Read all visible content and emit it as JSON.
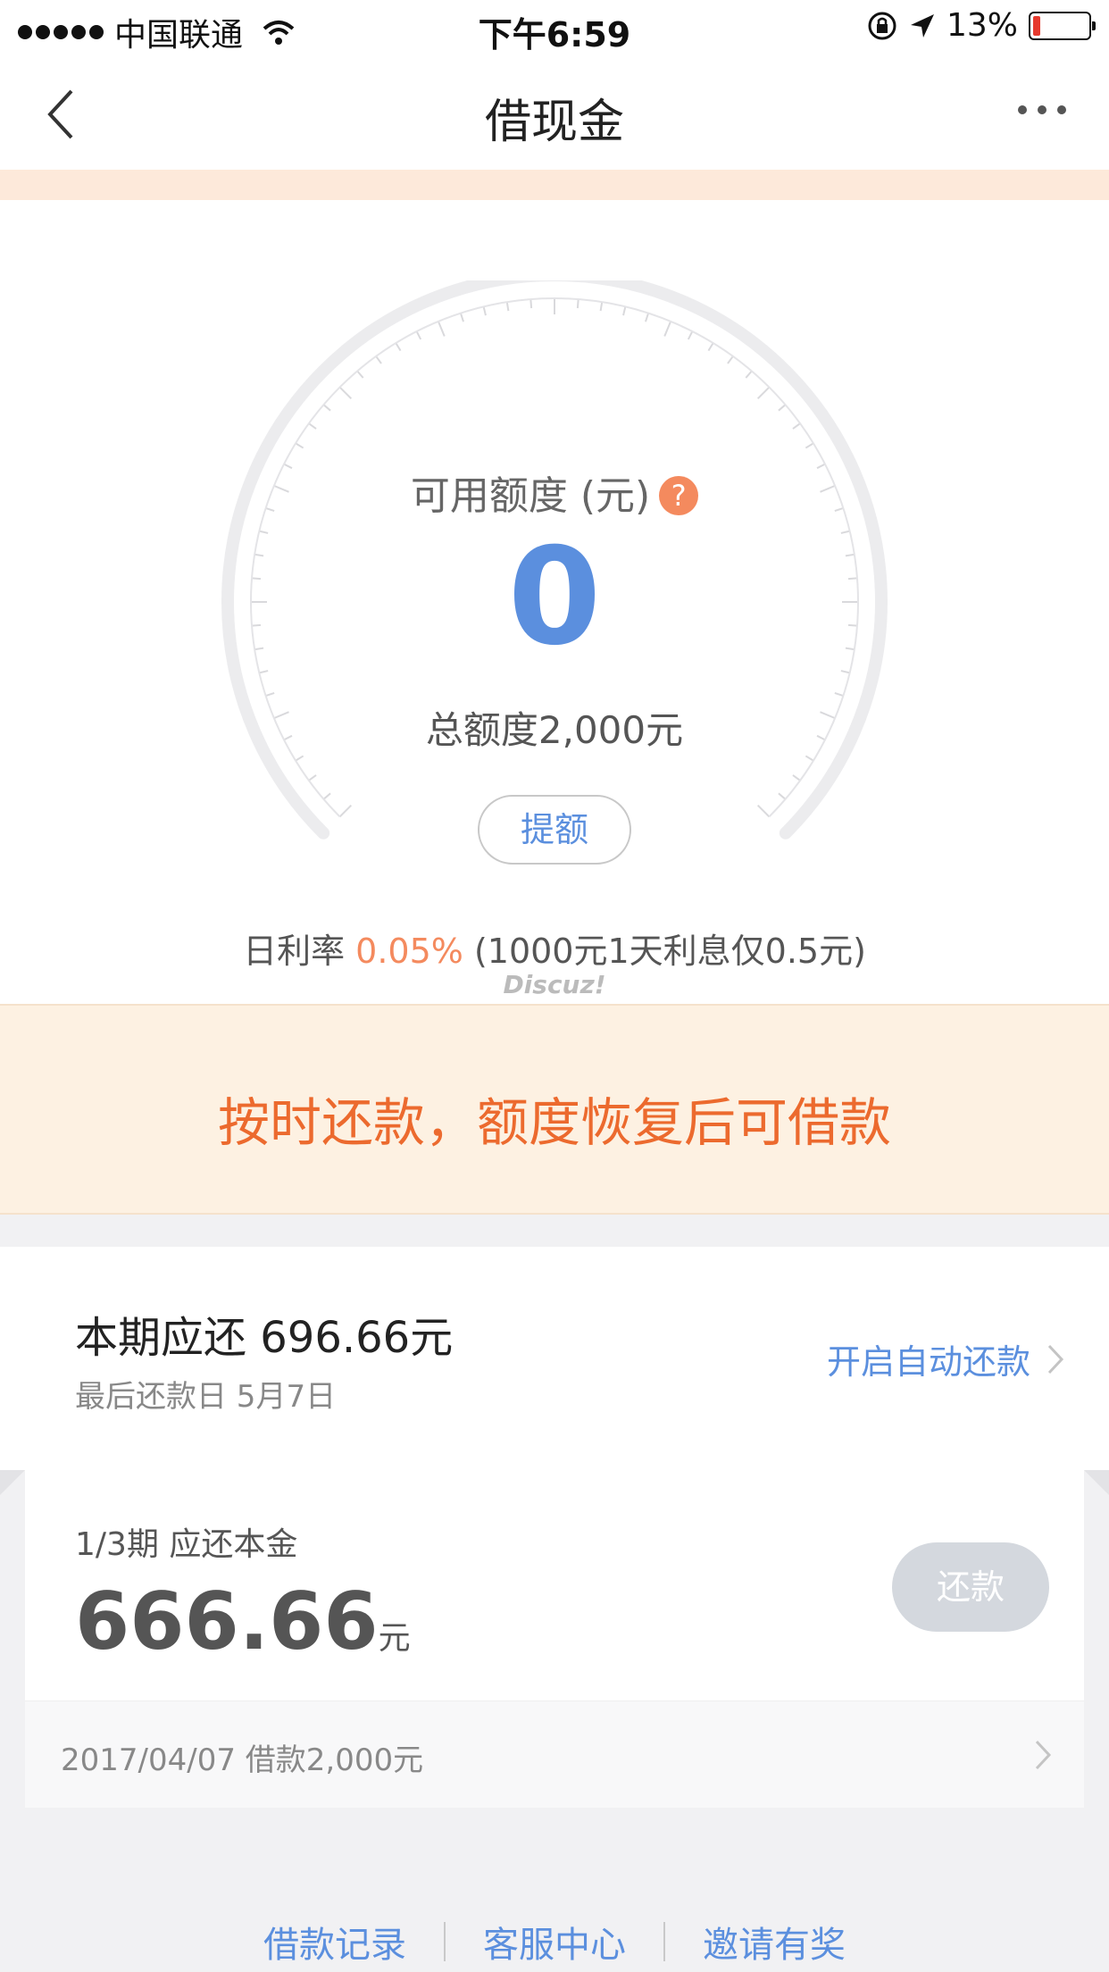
{
  "status_bar": {
    "carrier": "中国联通",
    "time": "下午6:59",
    "battery_percent": "13%",
    "battery_level": 0.13
  },
  "nav": {
    "title": "借现金",
    "back_icon": "chevron-left-icon",
    "more_icon": "more-dots-icon"
  },
  "gauge": {
    "label": "可用额度 (元)",
    "help_icon": "?",
    "value": "0",
    "total": "总额度2,000元",
    "raise_button": "提额"
  },
  "rate": {
    "prefix": "日利率 ",
    "value": "0.05%",
    "suffix": " (1000元1天利息仅0.5元)"
  },
  "watermark": "Discuz!",
  "notice": {
    "text": "按时还款，额度恢复后可借款"
  },
  "due": {
    "title": "本期应还 696.66元",
    "last_date": "最后还款日 5月7日",
    "autopay_link": "开启自动还款"
  },
  "installment": {
    "label": "1/3期 应还本金",
    "amount": "666.66",
    "unit": "元",
    "repay_button": "还款",
    "loan_info": "2017/04/07 借款2,000元"
  },
  "footer": {
    "links": [
      "借款记录",
      "客服中心",
      "邀请有奖"
    ]
  },
  "colors": {
    "accent_blue": "#5b8fde",
    "accent_orange": "#ec6a2e",
    "rate_orange": "#f48a5e",
    "notice_bg": "#fdf1e2"
  }
}
